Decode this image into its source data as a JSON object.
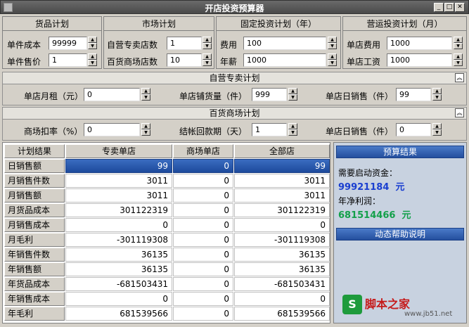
{
  "window": {
    "title": "开店投资预算器"
  },
  "plans": {
    "goods": {
      "title": "货品计划",
      "rows": [
        {
          "label": "单件成本",
          "value": "99999"
        },
        {
          "label": "单件售价",
          "value": "1"
        }
      ]
    },
    "market": {
      "title": "市场计划",
      "rows": [
        {
          "label": "自营专卖店数",
          "value": "1"
        },
        {
          "label": "百货商场店数",
          "value": "10"
        }
      ]
    },
    "fixed": {
      "title": "固定投资计划（年）",
      "rows": [
        {
          "label": "费用",
          "value": "100"
        },
        {
          "label": "年薪",
          "value": "1000"
        }
      ]
    },
    "opex": {
      "title": "营运投资计划（月）",
      "rows": [
        {
          "label": "单店费用",
          "value": "1000"
        },
        {
          "label": "单店工资",
          "value": "1000"
        }
      ]
    }
  },
  "self_store": {
    "title": "自营专卖计划",
    "fields": [
      {
        "label": "单店月租（元）",
        "value": "0"
      },
      {
        "label": "单店铺货量（件）",
        "value": "999"
      },
      {
        "label": "单店日销售（件）",
        "value": "99"
      }
    ]
  },
  "dept_store": {
    "title": "百货商场计划",
    "fields": [
      {
        "label": "商场扣率（%）",
        "value": "0"
      },
      {
        "label": "结帐回款期（天）",
        "value": "1"
      },
      {
        "label": "单店日销售（件）",
        "value": "0"
      }
    ]
  },
  "table": {
    "headers": [
      "计划结果",
      "专卖单店",
      "商场单店",
      "全部店"
    ],
    "rows": [
      {
        "label": "日销售额",
        "c1": "99",
        "c2": "0",
        "c3": "99"
      },
      {
        "label": "月销售件数",
        "c1": "3011",
        "c2": "0",
        "c3": "3011"
      },
      {
        "label": "月销售额",
        "c1": "3011",
        "c2": "0",
        "c3": "3011"
      },
      {
        "label": "月货品成本",
        "c1": "301122319",
        "c2": "0",
        "c3": "301122319"
      },
      {
        "label": "月销售成本",
        "c1": "0",
        "c2": "0",
        "c3": "0"
      },
      {
        "label": "月毛利",
        "c1": "-301119308",
        "c2": "0",
        "c3": "-301119308"
      },
      {
        "label": "年销售件数",
        "c1": "36135",
        "c2": "0",
        "c3": "36135"
      },
      {
        "label": "年销售额",
        "c1": "36135",
        "c2": "0",
        "c3": "36135"
      },
      {
        "label": "年货品成本",
        "c1": "-681503431",
        "c2": "0",
        "c3": "-681503431"
      },
      {
        "label": "年销售成本",
        "c1": "0",
        "c2": "0",
        "c3": "0"
      },
      {
        "label": "年毛利",
        "c1": "681539566",
        "c2": "0",
        "c3": "681539566"
      }
    ]
  },
  "budget": {
    "title": "预算结果",
    "capital_label": "需要启动资金：",
    "capital_value": "99921184",
    "capital_unit": "元",
    "profit_label": "年净利润：",
    "profit_value": "681514466",
    "profit_unit": "元",
    "help_title": "动态帮助说明"
  },
  "watermark": {
    "text": "脚本之家",
    "url": "www.jb51.net",
    "logo_letter": "S"
  },
  "colors": {
    "accent_blue": "#1d4a9c",
    "capital_color": "#1a3fd0",
    "profit_color": "#13a04a"
  }
}
